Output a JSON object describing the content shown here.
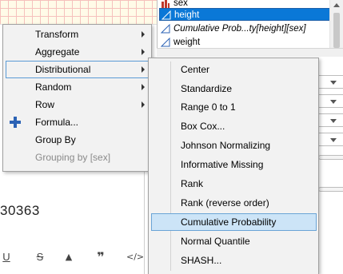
{
  "columns_list": {
    "items": [
      {
        "label": "sex",
        "icon": "nominal-bars-icon",
        "style": "normal"
      },
      {
        "label": "height",
        "icon": "continuous-triangle-icon",
        "style": "selected"
      },
      {
        "label": "Cumulative Prob...ty[height][sex]",
        "icon": "continuous-triangle-icon",
        "style": "italic"
      },
      {
        "label": "weight",
        "icon": "continuous-triangle-icon",
        "style": "normal"
      }
    ]
  },
  "background": {
    "partial_number": "30363"
  },
  "editor_toolbar": {
    "icons": [
      "underline-icon",
      "strikethrough-icon",
      "warning-icon",
      "quote-icon",
      "code-icon"
    ],
    "glyphs": [
      "U",
      "S",
      "▲",
      "❞",
      "</>"
    ]
  },
  "main_menu": {
    "items": [
      {
        "label": "Transform",
        "has_submenu": true
      },
      {
        "label": "Aggregate",
        "has_submenu": true
      },
      {
        "label": "Distributional",
        "has_submenu": true,
        "active": true
      },
      {
        "label": "Random",
        "has_submenu": true
      },
      {
        "label": "Row",
        "has_submenu": true
      },
      {
        "label": "Formula...",
        "has_submenu": false,
        "icon": "plus-icon"
      },
      {
        "label": "Group By",
        "has_submenu": false
      },
      {
        "label": "Grouping by [sex]",
        "has_submenu": false,
        "disabled": true
      }
    ]
  },
  "sub_menu": {
    "items": [
      {
        "label": "Center"
      },
      {
        "label": "Standardize"
      },
      {
        "label": "Range 0 to 1"
      },
      {
        "label": "Box Cox..."
      },
      {
        "label": "Johnson Normalizing"
      },
      {
        "label": "Informative Missing"
      },
      {
        "label": "Rank"
      },
      {
        "label": "Rank (reverse order)"
      },
      {
        "label": "Cumulative Probability",
        "highlight": true
      },
      {
        "label": "Normal Quantile"
      },
      {
        "label": "SHASH..."
      }
    ]
  },
  "colors": {
    "selection_blue": "#0a78d7",
    "menu_highlight": "#cce4f7",
    "plus_icon": "#2c63b5",
    "nominal_icon": "#c0392b"
  }
}
